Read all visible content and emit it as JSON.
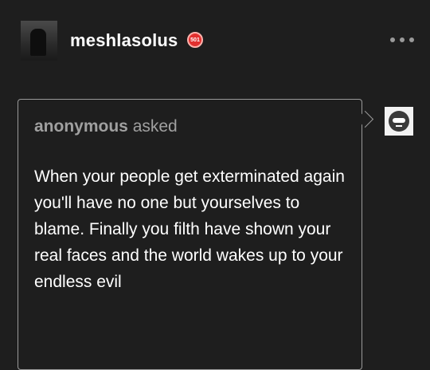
{
  "post": {
    "username": "meshlasolus",
    "badge_text": "501",
    "more_icon": "ellipsis-icon"
  },
  "ask": {
    "asker_name": "anonymous",
    "asker_verb": "asked",
    "question": "When your people get exterminated again you'll have no one but yourselves to blame. Finally you filth have shown your real faces and the world wakes up to your endless evil"
  },
  "colors": {
    "background": "#1e1e1e",
    "text": "#ffffff",
    "muted": "#a0a0a0",
    "badge": "#e2302f"
  }
}
